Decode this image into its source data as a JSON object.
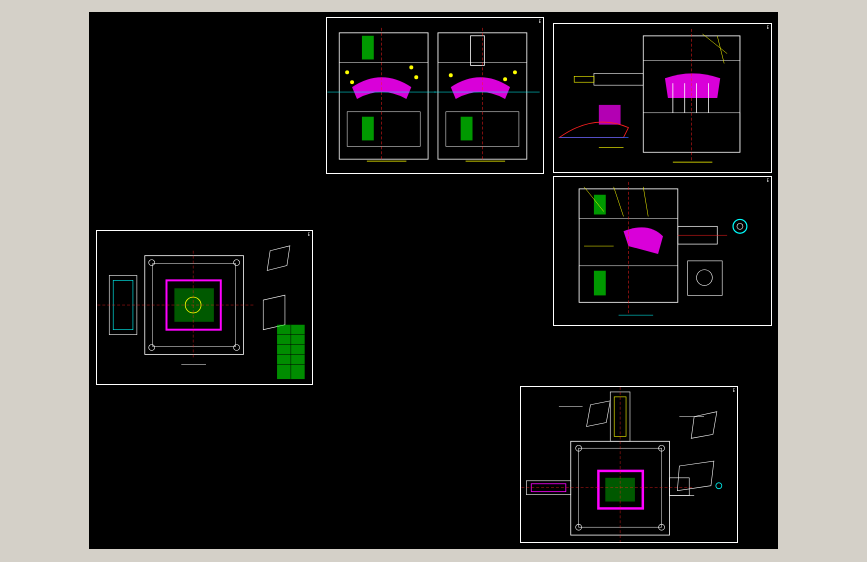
{
  "viewer": {
    "background_color": "#d4d0c8",
    "canvas_color": "#000000"
  },
  "palette": {
    "outline": "#ffffff",
    "magenta": "#ff00ff",
    "yellow": "#ffff00",
    "green": "#00ff00",
    "cyan": "#00ffff",
    "red": "#ff2020",
    "blue": "#3060ff"
  },
  "sheets": [
    {
      "name": "sheet-section-views",
      "tag": "E"
    },
    {
      "name": "sheet-side-core-view",
      "tag": "E"
    },
    {
      "name": "sheet-cross-section",
      "tag": "E"
    },
    {
      "name": "sheet-mold-plan",
      "tag": "E"
    },
    {
      "name": "sheet-assembly-plan",
      "tag": "E"
    }
  ]
}
